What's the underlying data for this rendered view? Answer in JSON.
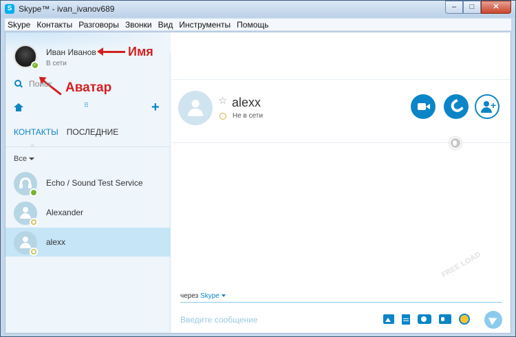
{
  "window": {
    "title": "Skype™ - ivan_ivanov689",
    "minimize": "–",
    "maximize": "□",
    "close": "✕"
  },
  "menu": [
    "Skype",
    "Контакты",
    "Разговоры",
    "Звонки",
    "Вид",
    "Инструменты",
    "Помощь"
  ],
  "profile": {
    "name": "Иван Иванов",
    "status": "В сети",
    "status_color": "#7bb32e"
  },
  "annotations": {
    "name_label": "Имя",
    "avatar_label": "Аватар",
    "color": "#d22020"
  },
  "search": {
    "label": "Поиск"
  },
  "toolbar": {
    "home_icon": "home-icon",
    "dialpad_icon": "dialpad-icon",
    "add_icon": "+"
  },
  "tabs": [
    {
      "label": "КОНТАКТЫ",
      "active": true
    },
    {
      "label": "ПОСЛЕДНИЕ",
      "active": false
    }
  ],
  "filter": {
    "label": "Все"
  },
  "contacts": [
    {
      "name": "Echo / Sound Test Service",
      "status": "online",
      "icon": "headset-icon"
    },
    {
      "name": "Alexander",
      "status": "offline",
      "icon": "person-icon"
    },
    {
      "name": "alexx",
      "status": "offline",
      "icon": "person-icon",
      "selected": true
    }
  ],
  "chat": {
    "contact_name": "alexx",
    "contact_status": "Не в сети",
    "favorite_icon": "☆",
    "video_call_icon": "video-camera-icon",
    "audio_call_icon": "phone-icon",
    "add_people_icon": "add-contact-icon",
    "via_label": "через",
    "via_service": "Skype",
    "message_placeholder": "Введите сообщение",
    "accent_color": "#0b85c8"
  },
  "watermark": "FREE LOAD"
}
